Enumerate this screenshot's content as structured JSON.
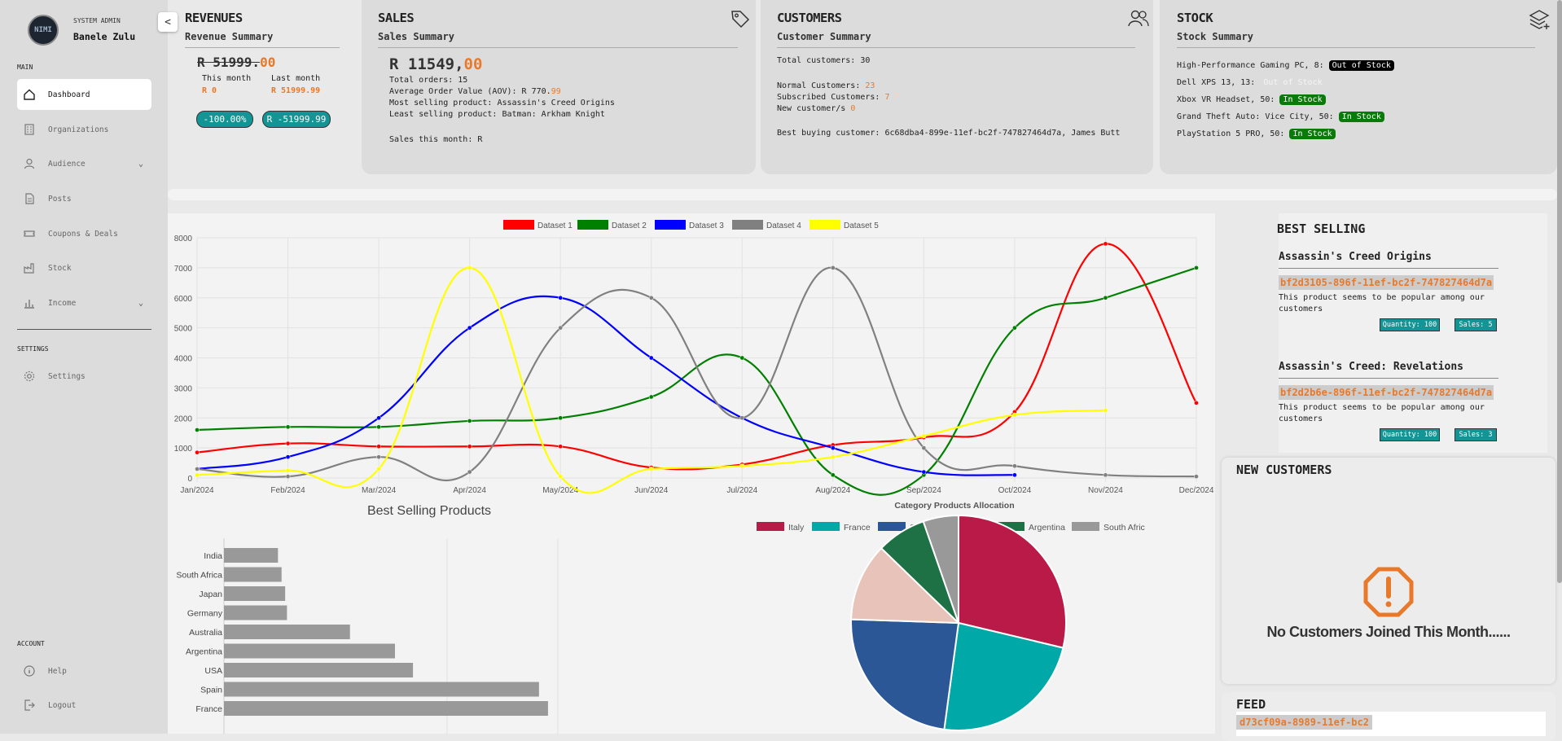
{
  "sidebar": {
    "role": "SYSTEM ADMIN",
    "user_name": "Banele Zulu",
    "avatar_text": "NIMI",
    "section_main": "MAIN",
    "section_settings": "SETTINGS",
    "section_account": "ACCOUNT",
    "items": [
      {
        "label": "Dashboard",
        "icon": "home-icon",
        "active": true
      },
      {
        "label": "Organizations",
        "icon": "building-icon"
      },
      {
        "label": "Audience",
        "icon": "user-icon",
        "expandable": true
      },
      {
        "label": "Posts",
        "icon": "document-icon"
      },
      {
        "label": "Coupons & Deals",
        "icon": "coupon-icon"
      },
      {
        "label": "Stock",
        "icon": "factory-icon"
      },
      {
        "label": "Income",
        "icon": "bar-chart-icon",
        "expandable": true
      }
    ],
    "settings_label": "Settings",
    "help_label": "Help",
    "logout_label": "Logout"
  },
  "revenues": {
    "title": "REVENUES",
    "subtitle": "Revenue Summary",
    "total_main": "R 51999.",
    "total_cents": "00",
    "this_month_label": "This month",
    "last_month_label": "Last month",
    "this_month_value": "R 0",
    "last_month_value": "R 51999.99",
    "pill_percent": "-100.00%",
    "pill_diff": "R -51999.99"
  },
  "sales": {
    "title": "SALES",
    "subtitle": "Sales Summary",
    "total_main": "R 11549,",
    "total_cents": "00",
    "total_orders": "Total orders: 15",
    "aov_prefix": "Average Order Value (AOV): R 770.",
    "aov_cents": "99",
    "most_selling": "Most selling product: Assassin's Creed Origins",
    "least_selling": "Least selling product: Batman: Arkham Knight",
    "sales_month": "Sales this month: R"
  },
  "customers": {
    "title": "CUSTOMERS",
    "subtitle": "Customer Summary",
    "total": "Total customers: 30",
    "normal_label": "Normal Customers: ",
    "normal_value": "23",
    "subscribed_label": "Subscribed Customers: ",
    "subscribed_value": "7",
    "new_label": "New customer/s ",
    "new_value": "0",
    "best_buying": "Best buying customer: 6c68dba4-899e-11ef-bc2f-747827464d7a, James Butt"
  },
  "stock": {
    "title": "STOCK",
    "subtitle": "Stock Summary",
    "items": [
      {
        "name": "High-Performance Gaming PC, 8:",
        "status": "Out of Stock",
        "style": "black"
      },
      {
        "name": "Dell XPS 13, 13:",
        "status": "Out of Stock",
        "style": "faded"
      },
      {
        "name": "Xbox VR Headset, 50:",
        "status": "In Stock",
        "style": "green"
      },
      {
        "name": "Grand Theft Auto: Vice City, 50:",
        "status": "In Stock",
        "style": "green"
      },
      {
        "name": "PlayStation 5 PRO, 50:",
        "status": "In Stock",
        "style": "green"
      }
    ]
  },
  "line_chart": {
    "chart_data": {
      "type": "line",
      "categories": [
        "Jan/2024",
        "Feb/2024",
        "Mar/2024",
        "Apr/2024",
        "May/2024",
        "Jun/2024",
        "Jul/2024",
        "Aug/2024",
        "Sep/2024",
        "Oct/2024",
        "Nov/2024",
        "Dec/2024"
      ],
      "ylim": [
        0,
        8000
      ],
      "yticks": [
        0,
        1000,
        2000,
        3000,
        4000,
        5000,
        6000,
        7000,
        8000
      ],
      "legend_position": "top",
      "series": [
        {
          "name": "Dataset 1",
          "color": "#ff0000",
          "values": [
            850,
            1150,
            1050,
            1050,
            1050,
            350,
            450,
            1100,
            1350,
            2200,
            7800,
            2500
          ]
        },
        {
          "name": "Dataset 2",
          "color": "#008000",
          "values": [
            1600,
            1700,
            1700,
            1900,
            2000,
            2700,
            4000,
            100,
            100,
            5000,
            6000,
            7000
          ]
        },
        {
          "name": "Dataset 3",
          "color": "#0000ff",
          "values": [
            300,
            700,
            2000,
            5000,
            6000,
            4000,
            2000,
            1000,
            200,
            100,
            null,
            null
          ]
        },
        {
          "name": "Dataset 4",
          "color": "#808080",
          "values": [
            300,
            50,
            700,
            200,
            5000,
            6000,
            2000,
            7000,
            1000,
            400,
            100,
            50
          ]
        },
        {
          "name": "Dataset 5",
          "color": "#ffff00",
          "values": [
            100,
            250,
            300,
            7000,
            50,
            300,
            400,
            700,
            1400,
            2100,
            2250,
            null
          ]
        }
      ]
    }
  },
  "bar_chart": {
    "chart_data": {
      "type": "bar",
      "orientation": "horizontal",
      "title": "Best Selling Products",
      "categories": [
        "India",
        "South Africa",
        "Japan",
        "Germany",
        "Australia",
        "Argentina",
        "USA",
        "Spain",
        "France"
      ],
      "values": [
        3,
        3.2,
        3.4,
        3.5,
        7,
        9.5,
        10.5,
        17.5,
        18
      ],
      "color": "#999999"
    }
  },
  "pie_chart": {
    "chart_data": {
      "type": "pie",
      "title": "Category Products Allocation",
      "legend_position": "top",
      "categories": [
        "Italy",
        "France",
        "Spain",
        "USA",
        "Argentina",
        "South Africa"
      ],
      "values": [
        27,
        22,
        22,
        11,
        7,
        5
      ],
      "colors": [
        "#b91a47",
        "#00a8a8",
        "#2b5797",
        "#e8c3b9",
        "#1e7145",
        "#999999"
      ]
    }
  },
  "best_selling": {
    "title": "BEST SELLING",
    "products": [
      {
        "name": "Assassin's Creed Origins",
        "id": "bf2d3105-896f-11ef-bc2f-747827464d7a",
        "desc": "This product seems to be popular among our customers",
        "qty": "Quantity: 100",
        "sales": "Sales: 5"
      },
      {
        "name": "Assassin's Creed: Revelations",
        "id": "bf2d2b6e-896f-11ef-bc2f-747827464d7a",
        "desc": "This product seems to be popular among our customers",
        "qty": "Quantity: 100",
        "sales": "Sales: 3"
      }
    ]
  },
  "new_customers": {
    "title": "NEW CUSTOMERS",
    "empty_message": "No Customers Joined This Month......"
  },
  "feed": {
    "title": "FEED",
    "first_id": "d73cf09a-8989-11ef-bc2"
  },
  "colors": {
    "accent_orange": "#e8792b",
    "teal": "#139595",
    "green": "#0a7a0a"
  }
}
